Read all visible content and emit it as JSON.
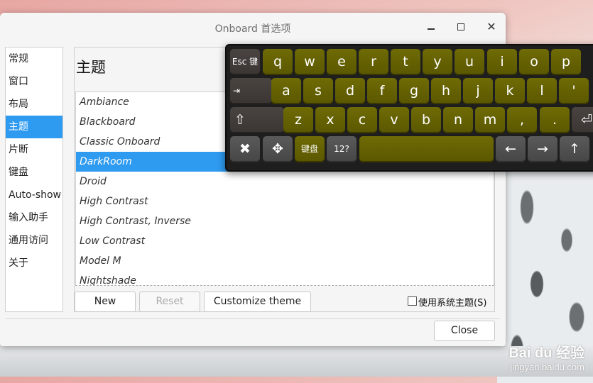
{
  "window": {
    "title": "Onboard 首选项",
    "minimize_label": "",
    "maximize_label": "",
    "close_label": "✕"
  },
  "sidebar": {
    "items": [
      {
        "label": "常规"
      },
      {
        "label": "窗口"
      },
      {
        "label": "布局"
      },
      {
        "label": "主题",
        "active": true
      },
      {
        "label": "片断"
      },
      {
        "label": "键盘"
      },
      {
        "label": "Auto-show"
      },
      {
        "label": "输入助手"
      },
      {
        "label": "通用访问"
      },
      {
        "label": "关于"
      }
    ]
  },
  "main": {
    "heading": "主题",
    "themes": [
      {
        "name": "Ambiance"
      },
      {
        "name": "Blackboard"
      },
      {
        "name": "Classic Onboard"
      },
      {
        "name": "DarkRoom",
        "selected": true
      },
      {
        "name": "Droid"
      },
      {
        "name": "High Contrast"
      },
      {
        "name": "High Contrast, Inverse"
      },
      {
        "name": "Low Contrast"
      },
      {
        "name": "Model M"
      },
      {
        "name": "Nightshade"
      }
    ],
    "buttons": {
      "new": "New",
      "reset": "Reset",
      "customize": "Customize theme"
    },
    "use_system_theme": "使用系统主题(S)",
    "close": "Close"
  },
  "keyboard": {
    "row1": [
      "Esc 键",
      "q",
      "w",
      "e",
      "r",
      "t",
      "y",
      "u",
      "i",
      "o",
      "p"
    ],
    "row2": [
      "⇥",
      "a",
      "s",
      "d",
      "f",
      "g",
      "h",
      "j",
      "k",
      "l",
      "'"
    ],
    "row3": [
      "⇧",
      "z",
      "x",
      "c",
      "v",
      "b",
      "n",
      "m",
      ",",
      ".",
      "⏎"
    ],
    "row4": [
      "✖",
      "✥",
      "键盘",
      "12?",
      "",
      "←",
      "→",
      "↑"
    ]
  },
  "watermark": {
    "logo": "Bai du 经验",
    "url": "jingyan.baidu.com"
  }
}
